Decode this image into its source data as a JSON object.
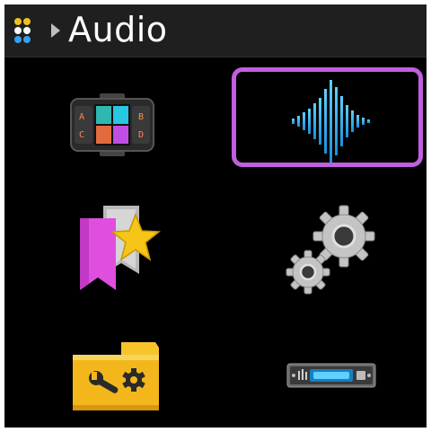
{
  "header": {
    "title": "Audio",
    "apps_icon": "apps-grid-icon",
    "breadcrumb_icon": "breadcrumb-arrow-icon"
  },
  "menu": {
    "items": [
      {
        "name": "abcd-mixer",
        "icon": "abcd-mixer-icon"
      },
      {
        "name": "waveform",
        "icon": "waveform-icon",
        "selected": true
      },
      {
        "name": "presets",
        "icon": "bookmark-star-icon"
      },
      {
        "name": "settings",
        "icon": "gears-icon"
      },
      {
        "name": "tools-folder",
        "icon": "folder-tools-icon"
      },
      {
        "name": "device",
        "icon": "rack-device-icon"
      }
    ]
  },
  "colors": {
    "background": "#000000",
    "header": "#1f1f1f",
    "selection": "#c15fe0",
    "waveform": "#3ab8f0",
    "bookmark": "#e04ee0",
    "star": "#f5c518",
    "folder": "#f3b71b"
  }
}
